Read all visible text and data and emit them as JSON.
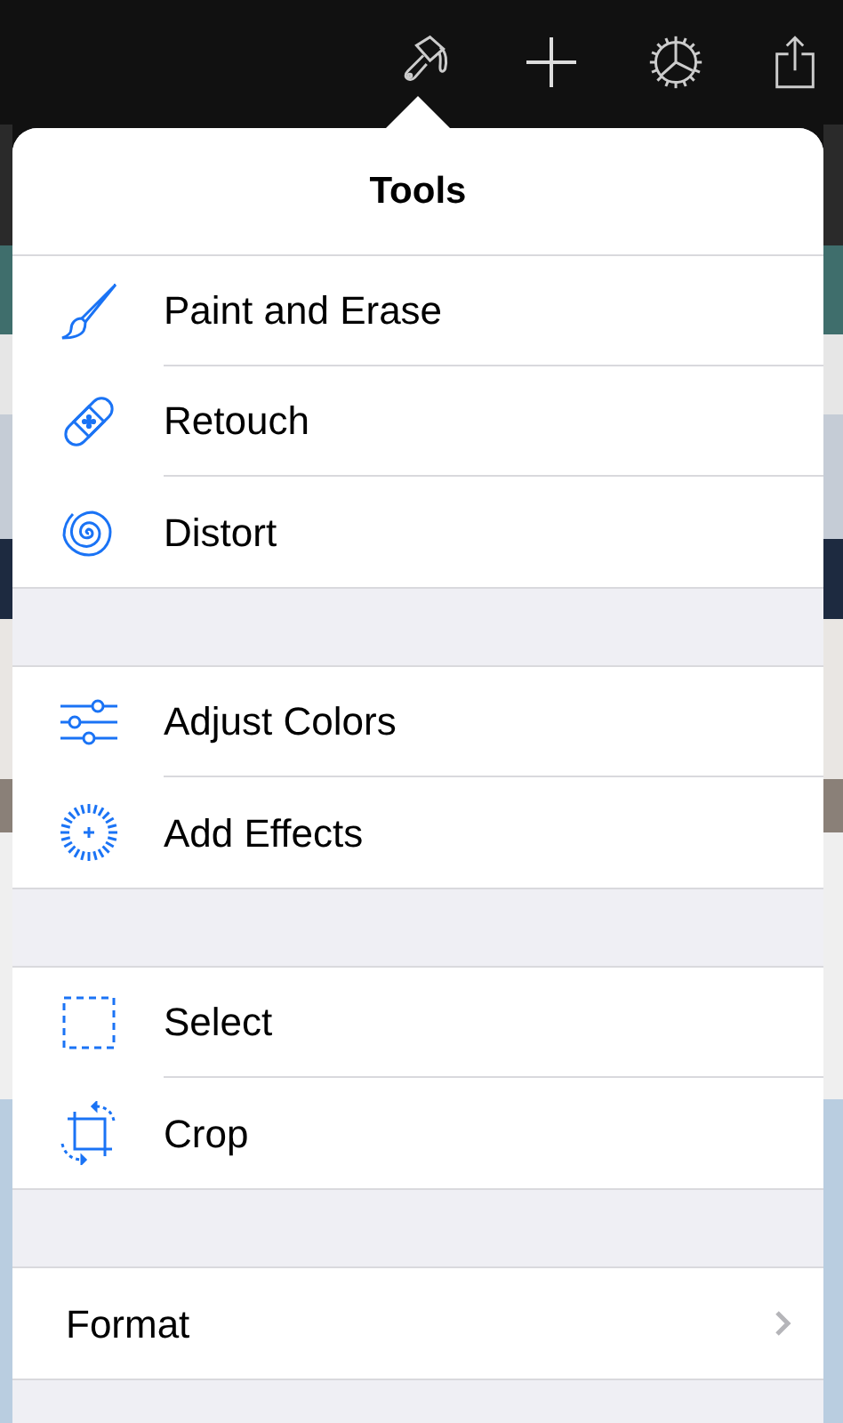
{
  "popover": {
    "title": "Tools",
    "sections": [
      {
        "items": [
          {
            "kind": "tool",
            "label": "Paint and Erase"
          },
          {
            "kind": "tool",
            "label": "Retouch"
          },
          {
            "kind": "tool",
            "label": "Distort"
          }
        ]
      },
      {
        "items": [
          {
            "kind": "tool",
            "label": "Adjust Colors"
          },
          {
            "kind": "tool",
            "label": "Add Effects"
          }
        ]
      },
      {
        "items": [
          {
            "kind": "tool",
            "label": "Select"
          },
          {
            "kind": "tool",
            "label": "Crop"
          }
        ]
      },
      {
        "items": [
          {
            "kind": "disclosure",
            "label": "Format"
          }
        ]
      }
    ]
  }
}
